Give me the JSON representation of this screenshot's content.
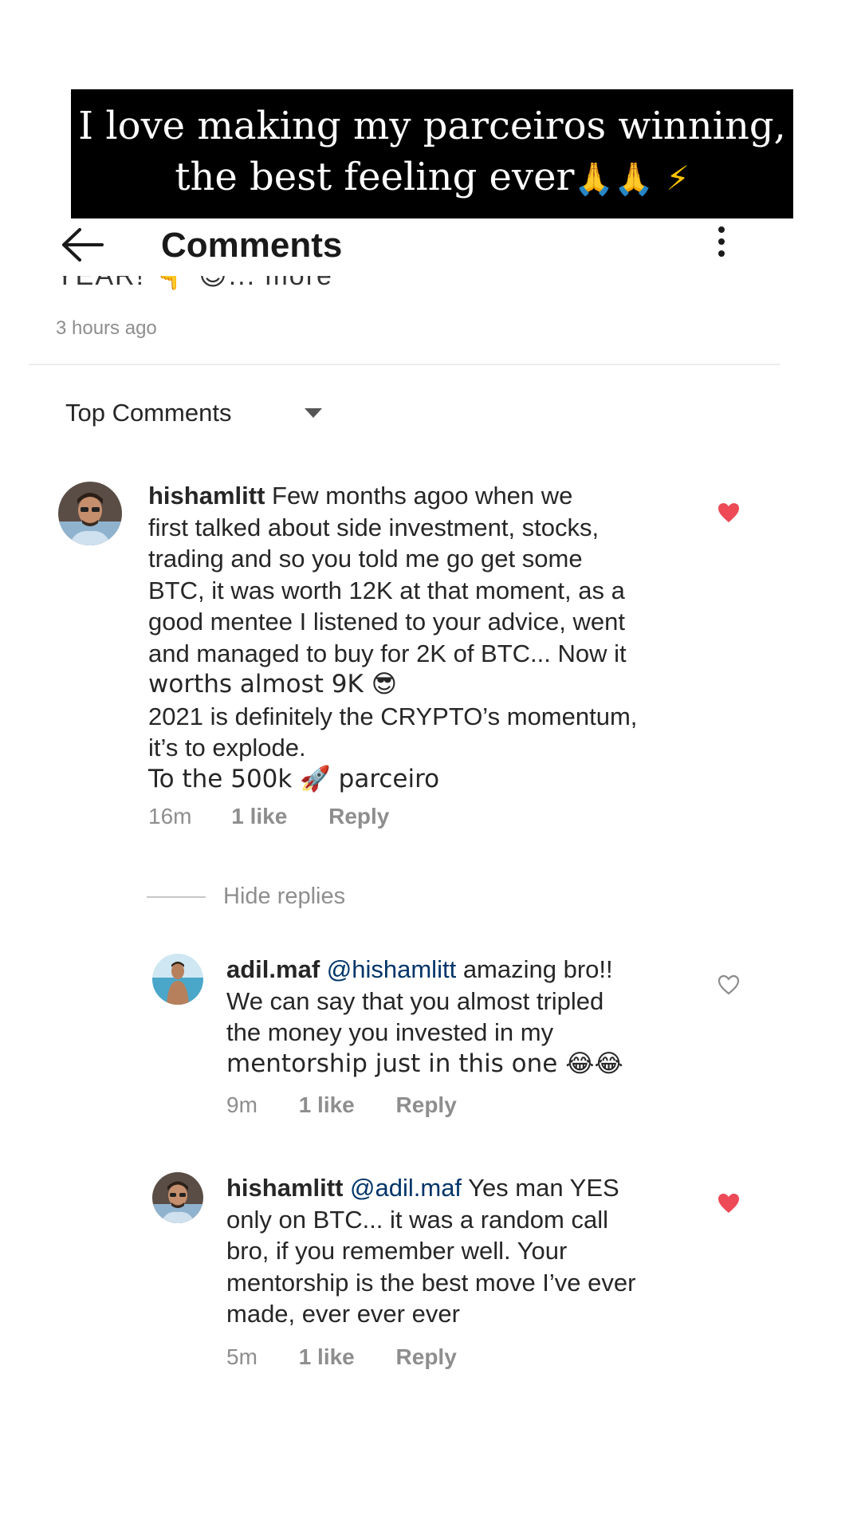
{
  "caption": {
    "line1": "I love making my parceiros winning,",
    "line2": "the best feeling ever",
    "emoji1": "🙏",
    "emoji2": "🙏",
    "emoji3": "⚡"
  },
  "header": {
    "title": "Comments"
  },
  "post": {
    "caption_fragment": "YEAR! 👇 😉... more",
    "timestamp": "3 hours ago"
  },
  "sort": {
    "label": "Top Comments"
  },
  "comments": [
    {
      "username": "hishamlitt",
      "text_lines": [
        "Few months agoo when we",
        "first talked about side investment, stocks,",
        "trading and so you told me go get some",
        "BTC, it was worth 12K at that moment, as a",
        "good mentee I listened to your advice, went",
        "and managed to buy for 2K of BTC... Now it",
        "worths almost 9K 😎",
        "2021 is definitely the CRYPTO’s momentum,",
        "it’s to explode.",
        "To the 500k 🚀 parceiro"
      ],
      "time": "16m",
      "likes": "1 like",
      "reply": "Reply",
      "liked": true
    }
  ],
  "hide_replies": "Hide replies",
  "replies": [
    {
      "username": "adil.maf",
      "mention": "@hishamlitt",
      "text_lines": [
        "amazing bro!!",
        "We can say that you almost tripled",
        "the money you invested in my",
        "mentorship just in this one 😂😂"
      ],
      "time": "9m",
      "likes": "1 like",
      "reply": "Reply",
      "liked": false
    },
    {
      "username": "hishamlitt",
      "mention": "@adil.maf",
      "text_lines": [
        "Yes man YES",
        "only on BTC... it was a random call",
        "bro, if you remember well. Your",
        "mentorship is the best move I’ve ever",
        "made, ever ever ever"
      ],
      "time": "5m",
      "likes": "1 like",
      "reply": "Reply",
      "liked": true
    }
  ],
  "colors": {
    "heart_liked": "#ed4956",
    "heart_outline": "#8e8e8e",
    "meta": "#8e8e8e",
    "mention": "#003569"
  },
  "icons": {
    "back": "arrow-left-icon",
    "menu": "more-vertical-icon",
    "caret": "caret-down-icon",
    "heart": "heart-icon"
  }
}
